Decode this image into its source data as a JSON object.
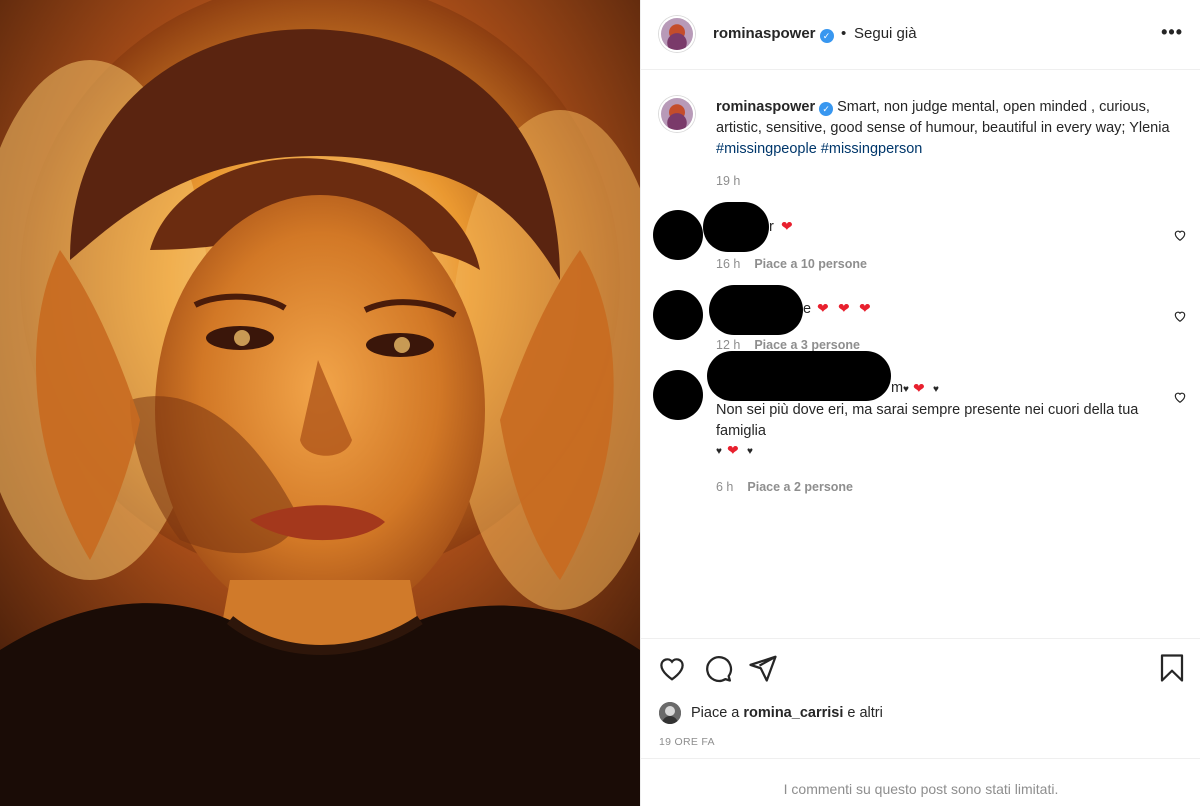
{
  "post": {
    "username": "rominaspower",
    "verified_mark": "✓",
    "separator": "•",
    "follow_status": "Segui già",
    "more_label": "•••",
    "icons": [
      "verified-badge-icon",
      "more-options-icon",
      "heart-icon",
      "comment-icon",
      "share-icon",
      "bookmark-icon"
    ]
  },
  "caption": {
    "username": "rominaspower",
    "text": "Smart, non judge mental, open minded , curious, artistic, sensitive, good sense of humour, beautiful in every way; Ylenia ",
    "hashtags": [
      "#missingpeople",
      "#missingperson"
    ],
    "time": "19 h"
  },
  "comments": [
    {
      "visible_fragment": "r",
      "hearts": [
        "❤"
      ],
      "time": "16 h",
      "likes": "Piace a 10 persone"
    },
    {
      "visible_fragment": "e",
      "hearts": [
        "❤",
        "❤",
        "❤"
      ],
      "time": "12 h",
      "likes": "Piace a 3 persone"
    },
    {
      "visible_fragment": "m",
      "hearts_line1": [
        "♥",
        "❤",
        "♥"
      ],
      "text": "Non sei più dove eri, ma sarai sempre presente nei cuori della tua famiglia",
      "hearts_line2": [
        "♥",
        "❤",
        "♥"
      ],
      "time": "6 h",
      "likes": "Piace a 2 persone"
    }
  ],
  "likes_summary": {
    "prefix": "Piace a ",
    "user": "romina_carrisi",
    "suffix": " e altri"
  },
  "posted_ago": "19 ORE FA",
  "comments_limited": "I commenti su questo post sono stati limitati.",
  "colors": {
    "accent": "#3897f0",
    "hashtag": "#00376b",
    "heart": "#e8202e",
    "muted": "#8e8e8e"
  }
}
